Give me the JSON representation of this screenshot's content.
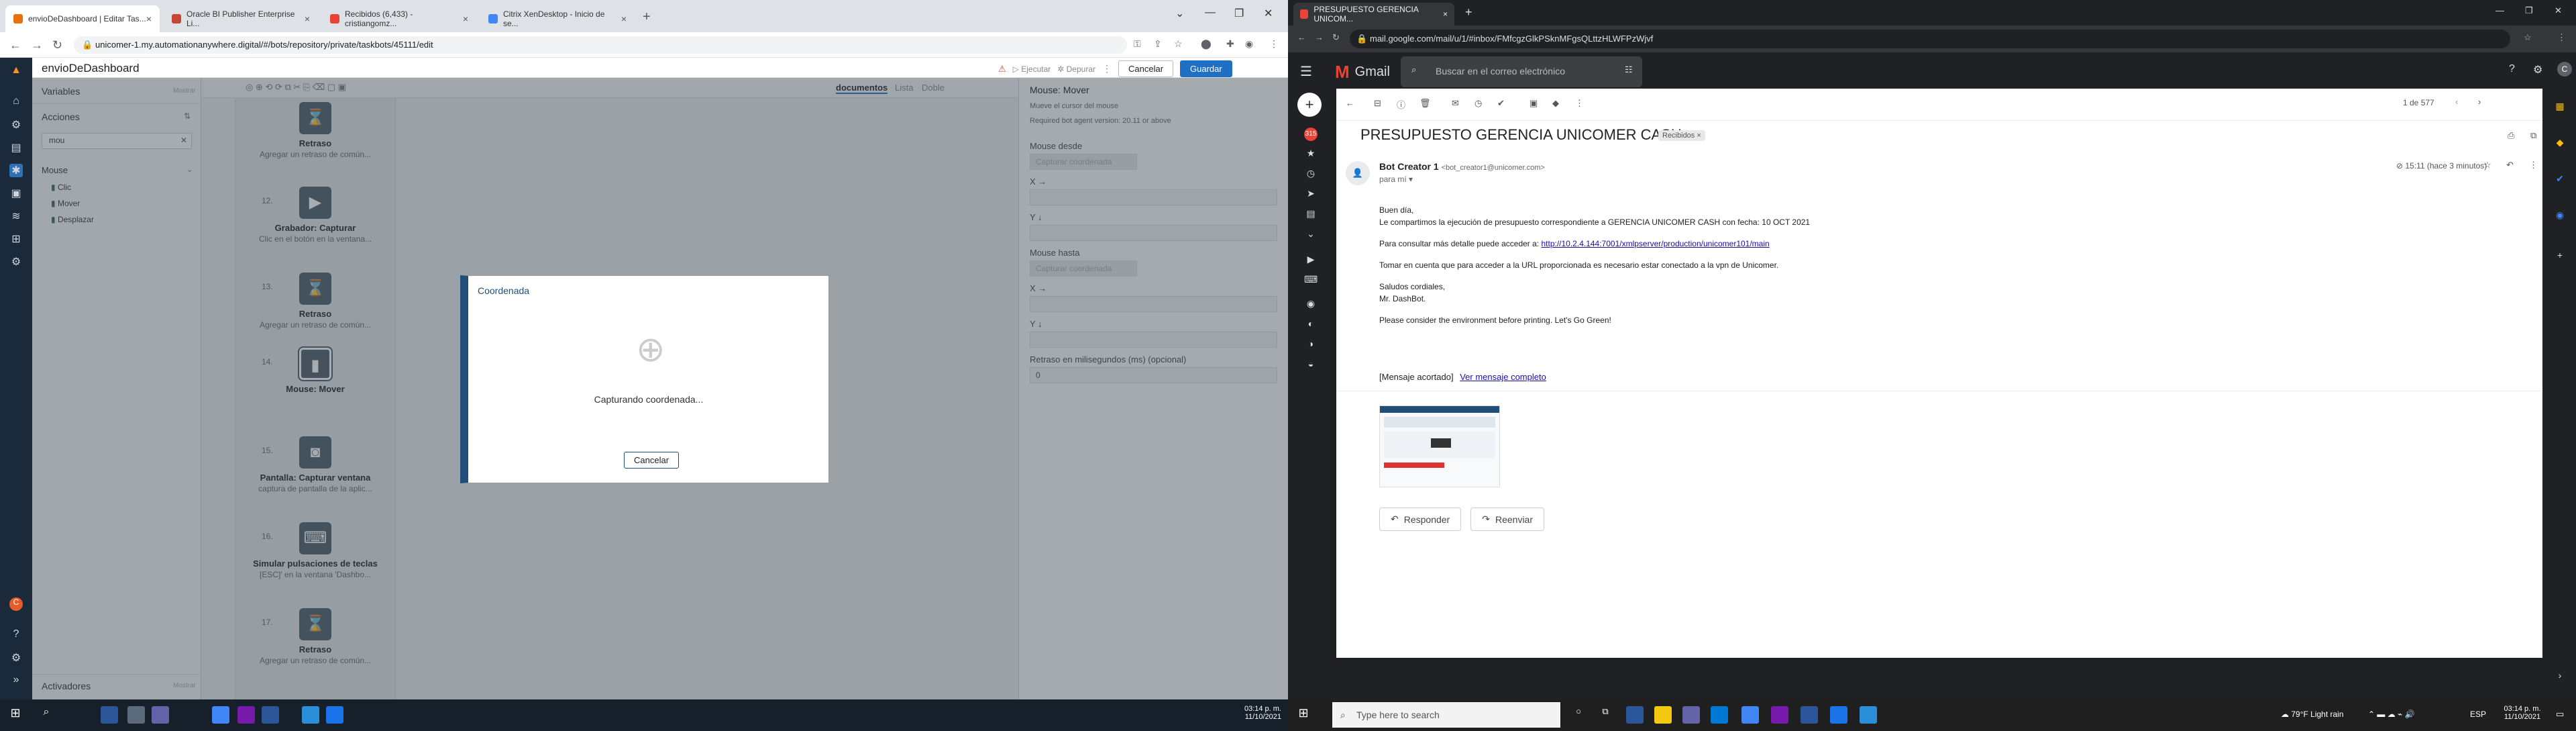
{
  "left_browser": {
    "tabs": [
      {
        "label": "envioDeDashboard | Editar Tas...",
        "color": "#e8710a"
      },
      {
        "label": "Oracle BI Publisher Enterprise Li...",
        "color": "#c74634"
      },
      {
        "label": "Recibidos (6,433) - cristiangomz...",
        "color": "#ea4335"
      },
      {
        "label": "Citrix XenDesktop - Inicio de se...",
        "color": "#4285f4"
      }
    ],
    "url": "unicomer-1.my.automationanywhere.digital/#/bots/repository/private/taskbots/45111/edit"
  },
  "aa": {
    "bot_name": "envioDeDashboard",
    "top_buttons": {
      "ejecutar": "Ejecutar",
      "depurar": "Depurar",
      "cancelar": "Cancelar",
      "guardar": "Guardar"
    },
    "left_pane": {
      "variables": "Variables",
      "acciones": "Acciones",
      "search_value": "mou",
      "group": "Mouse",
      "items": [
        "Clic",
        "Mover",
        "Desplazar"
      ],
      "activadores": "Activadores",
      "hidden_label": "Mostrar"
    },
    "flow_tabs": {
      "documentos": "documentos",
      "lista": "Lista",
      "doble": "Doble"
    },
    "steps": [
      {
        "num": "",
        "title": "Retraso",
        "desc": "Agregar un retraso de común..."
      },
      {
        "num": "12.",
        "title": "Grabador: Capturar",
        "desc": "Clic en el botón en la ventana..."
      },
      {
        "num": "13.",
        "title": "Retraso",
        "desc": "Agregar un retraso de común..."
      },
      {
        "num": "14.",
        "title": "Mouse: Mover",
        "desc": ""
      },
      {
        "num": "15.",
        "title": "Pantalla: Capturar ventana",
        "desc": "captura de pantalla de la aplic..."
      },
      {
        "num": "16.",
        "title": "Simular pulsaciones de teclas",
        "desc": "[ESC]' en la ventana 'Dashbo..."
      },
      {
        "num": "17.",
        "title": "Retraso",
        "desc": "Agregar un retraso de común..."
      }
    ],
    "right_pane": {
      "title": "Mouse: Mover",
      "subtitle": "Mueve el cursor del mouse",
      "version": "Required bot agent version: 20.11 or above",
      "mouse_desde": "Mouse desde",
      "capturar": "Capturar coordenada",
      "x_label": "X →",
      "y_label": "Y ↓",
      "mouse_hasta": "Mouse hasta",
      "retraso_label": "Retraso en milisegundos (ms) (opcional)",
      "retraso_value": "0"
    },
    "dialog": {
      "title": "Coordenada",
      "message": "Capturando coordenada...",
      "cancel": "Cancelar"
    }
  },
  "left_taskbar": {
    "time": "03:14 p. m.",
    "date": "11/10/2021"
  },
  "right_browser": {
    "tab": "PRESUPUESTO GERENCIA UNICOM...",
    "url": "mail.google.com/mail/u/1/#inbox/FMfcgzGlkPSknMFgsQLttzHLWFPzWjvf"
  },
  "gmail": {
    "brand": "Gmail",
    "search_placeholder": "Buscar en el correo electrónico",
    "badge": "315",
    "pager": "1 de 577",
    "subject": "PRESUPUESTO GERENCIA UNICOMER CASH",
    "label_chip": "Recibidos",
    "from_name": "Bot Creator 1",
    "from_email": "<bot_creator1@unicomer.com>",
    "to": "para mí",
    "time": "15:11 (hace 3 minutos)",
    "body": {
      "l1": "Buen día,",
      "l2": "Le compartimos la ejecución de presupuesto correspondiente a  GERENCIA UNICOMER CASH con fecha:  10 OCT 2021",
      "l3_prefix": "Para consultar más detalle puede acceder a: ",
      "l3_link": "http://10.2.4.144:7001/xmlpserver/production/unicomer101/main",
      "l4": "Tomar en cuenta que para acceder a la URL proporcionada es necesario estar conectado a la vpn de Unicomer.",
      "l5": "Saludos cordiales,",
      "l6": "Mr. DashBot.",
      "l7": "Please consider the environment before printing. Let's Go Green!"
    },
    "clipped": "[Mensaje acortado]",
    "view_full": "Ver mensaje completo",
    "reply": "Responder",
    "forward": "Reenviar"
  },
  "right_taskbar": {
    "search_placeholder": "Type here to search",
    "weather": "79°F  Light rain",
    "lang": "ESP",
    "time": "03:14 p. m.",
    "date": "11/10/2021"
  }
}
